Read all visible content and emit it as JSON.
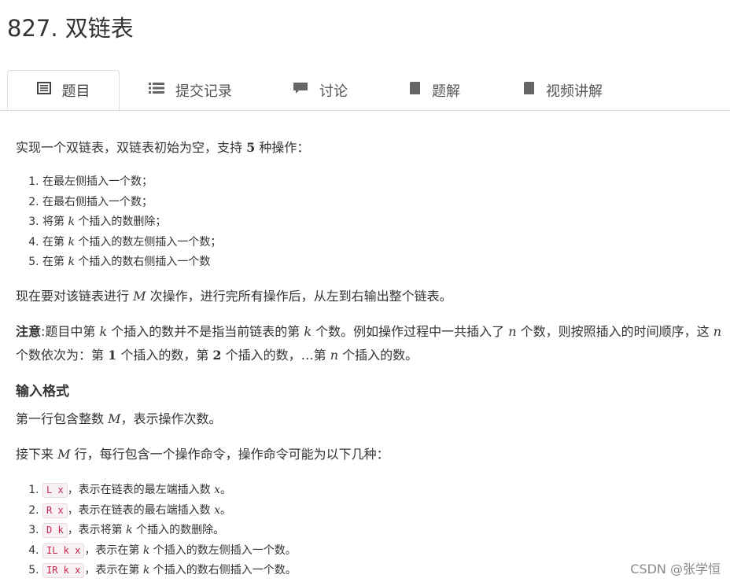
{
  "problem": {
    "title": "827. 双链表"
  },
  "tabs": [
    {
      "label": "题目",
      "icon": "list-icon",
      "active": true
    },
    {
      "label": "提交记录",
      "icon": "bulleted-list-icon",
      "active": false
    },
    {
      "label": "讨论",
      "icon": "comment-icon",
      "active": false
    },
    {
      "label": "题解",
      "icon": "book-icon",
      "active": false
    },
    {
      "label": "视频讲解",
      "icon": "book-icon",
      "active": false
    }
  ],
  "desc": {
    "intro_pre": "实现一个双链表，双链表初始为空，支持 ",
    "intro_num": "5",
    "intro_post": " 种操作：",
    "ops": [
      {
        "pre": "在最左侧插入一个数；",
        "var": "",
        "post": ""
      },
      {
        "pre": "在最右侧插入一个数；",
        "var": "",
        "post": ""
      },
      {
        "pre": "将第 ",
        "var": "k",
        "post": " 个插入的数删除；"
      },
      {
        "pre": "在第 ",
        "var": "k",
        "post": " 个插入的数左侧插入一个数；"
      },
      {
        "pre": "在第 ",
        "var": "k",
        "post": " 个插入的数右侧插入一个数"
      }
    ],
    "now_pre": "现在要对该链表进行 ",
    "now_var": "M",
    "now_post": " 次操作，进行完所有操作后，从左到右输出整个链表。",
    "note_label": "注意",
    "note_1": ":题目中第 ",
    "note_k1": "k",
    "note_2": " 个插入的数并不是指当前链表的第 ",
    "note_k2": "k",
    "note_3": " 个数。例如操作过程中一共插入了 ",
    "note_n1": "n",
    "note_4": " 个数，则按照插入的时间顺序，这 ",
    "note_n2": "n",
    "note_5": " 个数依次为：第 ",
    "note_one": "1",
    "note_6": " 个插入的数，第 ",
    "note_two": "2",
    "note_7": " 个插入的数，…第 ",
    "note_n3": "n",
    "note_8": " 个插入的数。"
  },
  "input_format": {
    "heading": "输入格式",
    "line1_pre": "第一行包含整数 ",
    "line1_var": "M",
    "line1_post": "，表示操作次数。",
    "line2_pre": "接下来 ",
    "line2_var": "M",
    "line2_post": " 行，每行包含一个操作命令，操作命令可能为以下几种：",
    "cmds": [
      {
        "code": "L x",
        "pre": "，表示在链表的最左端插入数 ",
        "var": "x",
        "post": "。"
      },
      {
        "code": "R x",
        "pre": "，表示在链表的最右端插入数 ",
        "var": "x",
        "post": "。"
      },
      {
        "code": "D k",
        "pre": "，表示将第 ",
        "var": "k",
        "post": " 个插入的数删除。"
      },
      {
        "code": "IL k x",
        "pre": "，表示在第 ",
        "var": "k",
        "post": " 个插入的数左侧插入一个数。"
      },
      {
        "code": "IR k x",
        "pre": "，表示在第 ",
        "var": "k",
        "post": " 个插入的数右侧插入一个数。"
      }
    ]
  },
  "watermark": "CSDN @张学恒"
}
